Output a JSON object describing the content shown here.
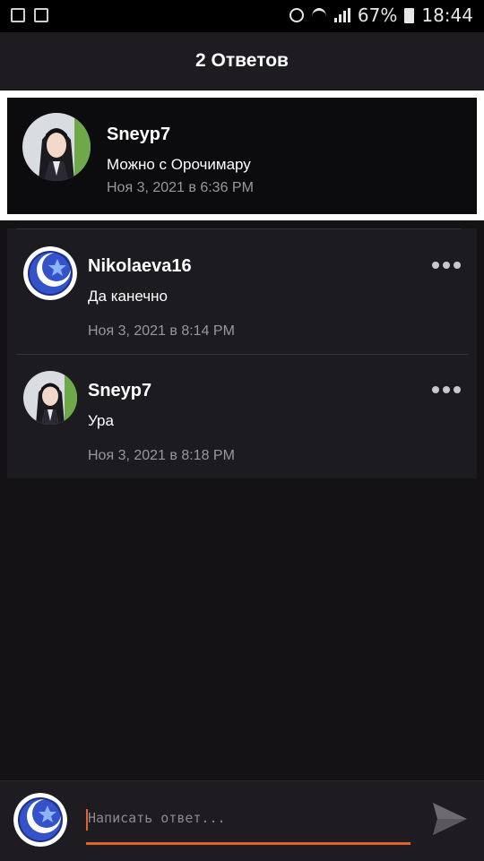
{
  "status_bar": {
    "battery": "67%",
    "time": "18:44",
    "icons": [
      "image-icon",
      "recycle-icon",
      "alarm-icon",
      "wifi-icon",
      "signal-icon",
      "battery-icon"
    ]
  },
  "header": {
    "title": "2 Ответов"
  },
  "parent_comment": {
    "username": "Sneyp7",
    "text": "Можно с Орочимару",
    "timestamp": "Ноя 3, 2021 в 6:36 PM"
  },
  "replies": [
    {
      "username": "Nikolaeva16",
      "text": "Да канечно",
      "timestamp": "Ноя 3, 2021 в 8:14 PM"
    },
    {
      "username": "Sneyp7",
      "text": "Ура",
      "timestamp": "Ноя 3, 2021 в 8:18 PM"
    }
  ],
  "composer": {
    "placeholder": "Написать ответ..."
  },
  "colors": {
    "accent": "#e0632a",
    "background": "#141215",
    "card": "#1c1b1f",
    "highlight_border": "#ffffff"
  }
}
